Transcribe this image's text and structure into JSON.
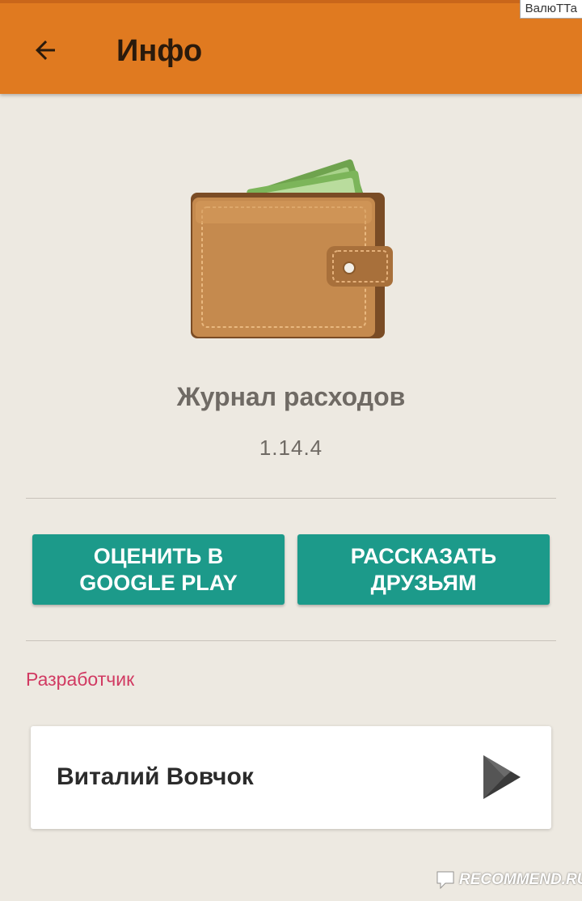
{
  "appbar": {
    "title": "Инфо",
    "back_icon": "arrow-back-icon",
    "color": "#e07a20"
  },
  "watermark_top": "ВалюТТа",
  "app": {
    "icon": "wallet-icon",
    "name": "Журнал расходов",
    "version": "1.14.4"
  },
  "buttons": {
    "rate": "ОЦЕНИТЬ В GOOGLE PLAY",
    "share": "РАССКАЗАТЬ ДРУЗЬЯМ",
    "color": "#1c9a8a"
  },
  "developer": {
    "section_label": "Разработчик",
    "name": "Виталий Вовчок",
    "store_icon": "play-store-icon"
  },
  "watermark_bottom": "RECOMMEND.RU",
  "colors": {
    "background": "#ede9e1",
    "accent_label": "#d13a62"
  }
}
